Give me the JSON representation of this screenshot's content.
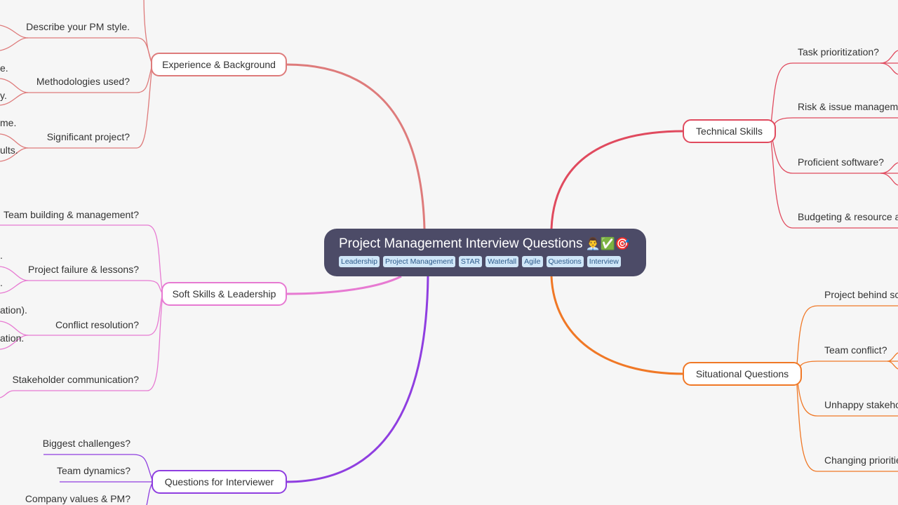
{
  "root": {
    "title": "Project Management Interview Questions",
    "emoji": "👨‍💼✅🎯",
    "tags": [
      "Leadership",
      "Project Management",
      "STAR",
      "Waterfall",
      "Agile",
      "Questions",
      "Interview"
    ]
  },
  "branches": {
    "experience": {
      "label": "Experience & Background",
      "color": "#de7b7b",
      "children": [
        "Describe your PM style.",
        "Methodologies used?",
        "Significant project?"
      ],
      "fragments": [
        "e.",
        "y.",
        "me.",
        "ults."
      ]
    },
    "soft_skills": {
      "label": "Soft Skills & Leadership",
      "color": "#e77ad2",
      "children": [
        "Team building & management?",
        "Project failure & lessons?",
        "Conflict resolution?",
        "Stakeholder communication?"
      ],
      "fragments": [
        ".",
        ".",
        "ation).",
        "ation."
      ]
    },
    "questions_interviewer": {
      "label": "Questions for Interviewer",
      "color": "#8f3ee0",
      "children": [
        "Biggest challenges?",
        "Team dynamics?",
        "Company values & PM?"
      ]
    },
    "technical": {
      "label": "Technical Skills",
      "color": "#e04a5e",
      "children": [
        "Task prioritization?",
        "Risk & issue managemen",
        "Proficient software?",
        "Budgeting & resource all"
      ]
    },
    "situational": {
      "label": "Situational Questions",
      "color": "#f07826",
      "children": [
        "Project behind sch",
        "Team conflict?",
        "Unhappy stakeho",
        "Changing prioritie"
      ]
    }
  }
}
